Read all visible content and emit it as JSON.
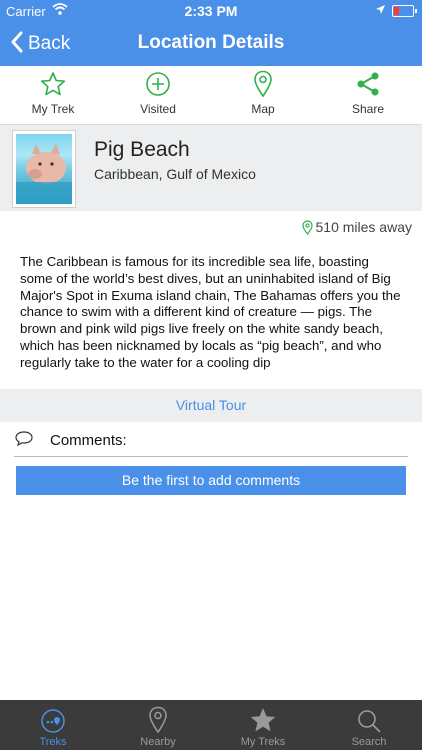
{
  "status": {
    "carrier": "Carrier",
    "time": "2:33 PM"
  },
  "nav": {
    "back_label": "Back",
    "title": "Location Details"
  },
  "actions": [
    {
      "label": "My Trek",
      "icon": "star-outline-icon"
    },
    {
      "label": "Visited",
      "icon": "plus-circle-icon"
    },
    {
      "label": "Map",
      "icon": "map-pin-icon"
    },
    {
      "label": "Share",
      "icon": "share-icon"
    }
  ],
  "location": {
    "name": "Pig Beach",
    "region": "Caribbean, Gulf of Mexico",
    "distance": "510 miles away",
    "description": "The Caribbean is famous for its incredible sea life, boasting some of the world’s best dives, but an uninhabited island of Big Major's Spot in Exuma island chain, The Bahamas offers you the chance to swim with a different kind of creature — pigs. The brown and pink wild pigs live freely on the white sandy beach, which has been nicknamed by locals as “pig beach”, and who regularly take to the water for a cooling dip"
  },
  "virtual_tour_label": "Virtual Tour",
  "comments": {
    "label": "Comments:",
    "add_button": "Be the first to add comments"
  },
  "tabs": [
    {
      "label": "Treks",
      "icon": "treks-icon",
      "active": true
    },
    {
      "label": "Nearby",
      "icon": "location-pin-icon",
      "active": false
    },
    {
      "label": "My Treks",
      "icon": "star-filled-icon",
      "active": false
    },
    {
      "label": "Search",
      "icon": "search-icon",
      "active": false
    }
  ],
  "colors": {
    "brand": "#4a8fe8",
    "accent_green": "#2fb04b",
    "tabbar": "#3b3b3b"
  }
}
